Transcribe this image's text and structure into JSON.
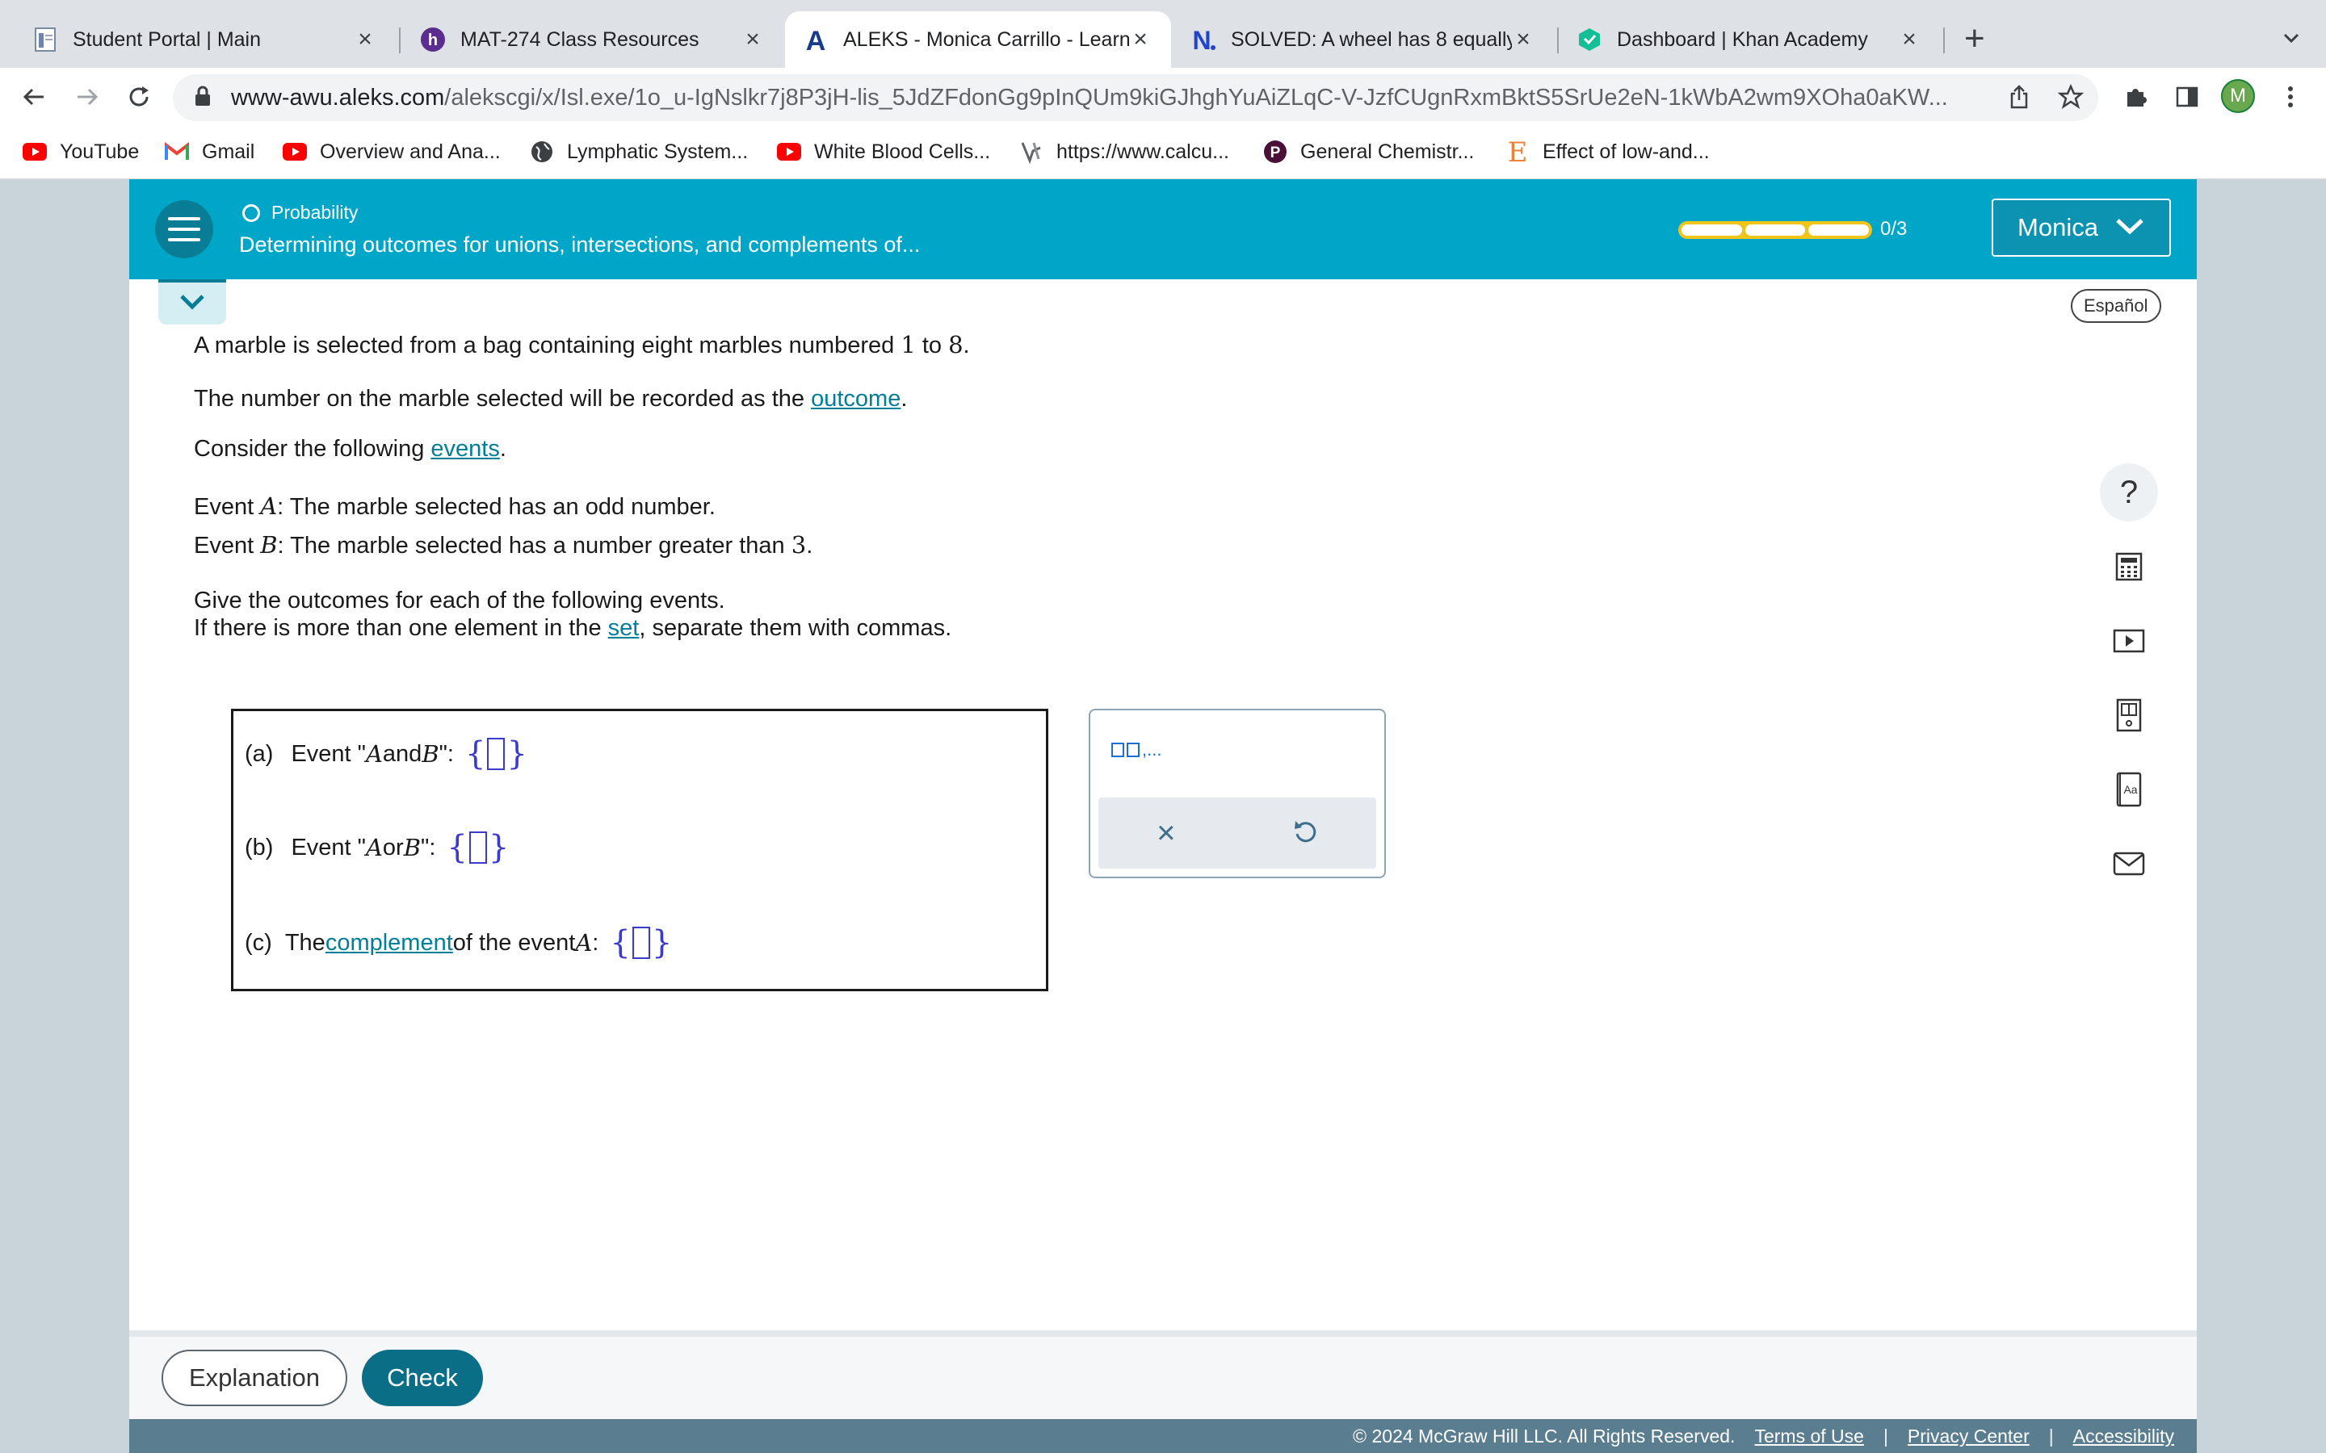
{
  "browser": {
    "tabs": [
      {
        "title": "Student Portal | Main",
        "icon": "document-icon"
      },
      {
        "title": "MAT-274 Class Resources",
        "icon": "h-logo-icon"
      },
      {
        "title": "ALEKS - Monica Carrillo - Learn",
        "icon": "aleks-a-icon",
        "active": true
      },
      {
        "title": "SOLVED: A wheel has 8 equally",
        "icon": "numerade-n-icon"
      },
      {
        "title": "Dashboard | Khan Academy",
        "icon": "khan-academy-icon"
      }
    ],
    "url_host": "www-awu.aleks.com",
    "url_path": "/alekscgi/x/Isl.exe/1o_u-IgNslkr7j8P3jH-lis_5JdZFdonGg9pInQUm9kiGJhghYuAiZLqC-V-JzfCUgnRxmBktS5SrUe2eN-1kWbA2wm9XOha0aKW...",
    "profile_initial": "M"
  },
  "bookmarks": [
    {
      "label": "YouTube",
      "icon": "youtube-icon"
    },
    {
      "label": "Gmail",
      "icon": "gmail-icon"
    },
    {
      "label": "Overview and Ana...",
      "icon": "youtube-icon"
    },
    {
      "label": "Lymphatic System...",
      "icon": "globe-icon"
    },
    {
      "label": "White Blood Cells...",
      "icon": "youtube-icon"
    },
    {
      "label": "https://www.calcu...",
      "icon": "calculator-site-icon"
    },
    {
      "label": "General Chemistr...",
      "icon": "p-logo-icon"
    },
    {
      "label": "Effect of low-and...",
      "icon": "e-logo-icon"
    }
  ],
  "header": {
    "topic": "Probability",
    "subtopic": "Determining outcomes for unions, intersections, and complements of...",
    "progress_label": "0/3",
    "progress_value": 0,
    "user_name": "Monica",
    "accent_color": "#00a6c8"
  },
  "language_button": "Español",
  "problem": {
    "l1_a": "A marble is selected from a bag containing eight marbles numbered ",
    "l1_n1": "1",
    "l1_b": " to ",
    "l1_n2": "8",
    "l1_c": ".",
    "l2_a": "The number on the marble selected will be recorded as the ",
    "l2_link": "outcome",
    "l2_b": ".",
    "l3_a": "Consider the following ",
    "l3_link": "events",
    "l3_b": ".",
    "ea_pre": "Event ",
    "ea_var": "A",
    "ea_text": ": The marble selected has an odd number.",
    "eb_pre": "Event ",
    "eb_var": "B",
    "eb_text": ": The marble selected has a number greater than ",
    "eb_num": "3",
    "eb_end": ".",
    "i1": "Give the outcomes for each of the following events.",
    "i2_a": "If there is more than one element in the ",
    "i2_link": "set",
    "i2_b": ", separate them with commas."
  },
  "answers": {
    "a_label": "(a)",
    "a_pre": "Event \"",
    "a_var1": "A",
    "a_mid": " and ",
    "a_var2": "B",
    "a_post": " \":",
    "b_label": "(b)",
    "b_pre": "Event \"",
    "b_var1": "A",
    "b_mid": " or ",
    "b_var2": "B",
    "b_post": " \":",
    "c_label": "(c)",
    "c_pre": "The ",
    "c_link": "complement",
    "c_mid": " of the event ",
    "c_var": "A",
    "c_post": ":"
  },
  "palette": {
    "list_template": ",...",
    "clear_symbol": "×"
  },
  "side_tools": [
    "question-icon",
    "calculator-icon",
    "video-icon",
    "textbook-icon",
    "dictionary-icon",
    "mail-icon"
  ],
  "side_tools_question": "?",
  "side_tools_dictionary": "Aa",
  "buttons": {
    "explanation": "Explanation",
    "check": "Check"
  },
  "footer": {
    "copyright": "© 2024 McGraw Hill LLC. All Rights Reserved.",
    "terms": "Terms of Use",
    "privacy": "Privacy Center",
    "accessibility": "Accessibility",
    "separator": "|"
  }
}
